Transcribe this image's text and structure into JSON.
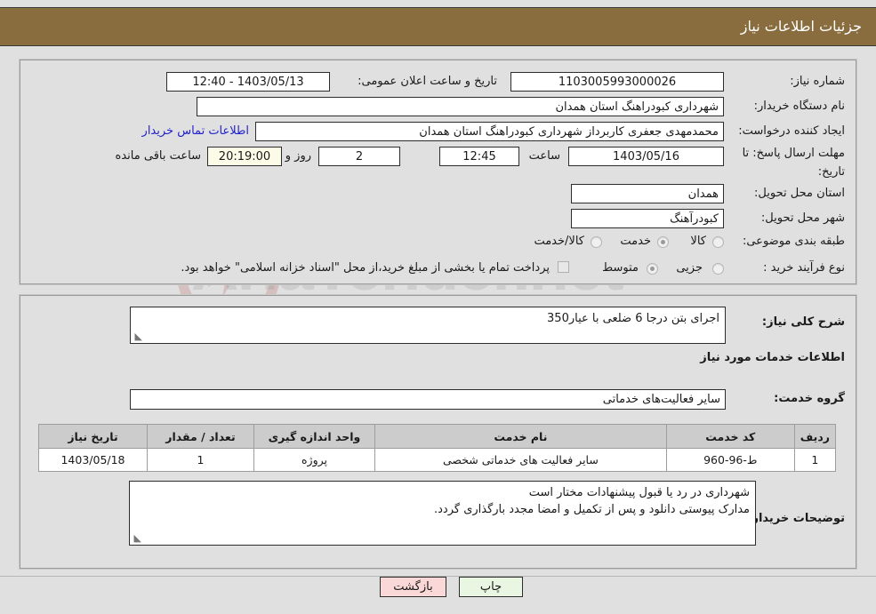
{
  "header": {
    "title": "جزئیات اطلاعات نیاز",
    "bg_color": "#8a6d3f",
    "text_color": "#ffffff"
  },
  "watermark": {
    "text": "AriaTender.net"
  },
  "top_form": {
    "need_number_label": "شماره نیاز:",
    "need_number_value": "1103005993000026",
    "public_announce_label": "تاریخ و ساعت اعلان عمومی:",
    "public_announce_value": "1403/05/13 - 12:40",
    "buyer_org_label": "نام دستگاه خریدار:",
    "buyer_org_value": "شهرداری کبودراهنگ استان همدان",
    "creator_label": "ایجاد کننده درخواست:",
    "creator_value": "محمدمهدی جعفری کاربرداز شهرداری کبودراهنگ استان همدان",
    "contact_link": "اطلاعات تماس خریدار",
    "deadline_label_line1": "مهلت ارسال پاسخ: تا",
    "deadline_label_line2": "تاریخ:",
    "deadline_date": "1403/05/16",
    "hour_label": "ساعت",
    "deadline_time": "12:45",
    "days_value": "2",
    "days_label": "روز و",
    "remaining_time": "20:19:00",
    "remaining_label": "ساعت باقی مانده",
    "province_label": "استان محل تحویل:",
    "province_value": "همدان",
    "city_label": "شهر محل تحویل:",
    "city_value": "کبودرآهنگ",
    "category_label": "طبقه بندی موضوعی:",
    "category_options": [
      "کالا",
      "خدمت",
      "کالا/خدمت"
    ],
    "category_selected": "خدمت",
    "process_label": "نوع فرآیند خرید :",
    "process_options": [
      "جزیی",
      "متوسط"
    ],
    "process_selected": "متوسط",
    "treasury_checkbox_label": "پرداخت تمام یا بخشی از مبلغ خرید،از محل \"اسناد خزانه اسلامی\" خواهد بود.",
    "treasury_checked": false
  },
  "mid_form": {
    "general_desc_label": "شرح کلی نیاز:",
    "general_desc_value": "اجرای بتن درجا 6 ضلعی با عیار350",
    "services_info_title": "اطلاعات خدمات مورد نیاز",
    "service_group_label": "گروه خدمت:",
    "service_group_value": "سایر فعالیت‌های خدماتی",
    "buyer_notes_label": "توضیحات خریدار:",
    "buyer_notes_value": "شهرداری در رد یا قبول پیشنهادات مختار است\nمدارک پیوستی دانلود و پس از تکمیل و امضا مجدد بارگذاری گردد."
  },
  "table": {
    "columns": [
      "ردیف",
      "کد خدمت",
      "نام خدمت",
      "واحد اندازه گیری",
      "تعداد / مقدار",
      "تاریخ نیاز"
    ],
    "rows": [
      {
        "row_no": "1",
        "service_code": "ط-96-960",
        "service_name": "سایر فعالیت های خدماتی شخصی",
        "unit": "پروژه",
        "quantity": "1",
        "need_date": "1403/05/18"
      }
    ]
  },
  "footer": {
    "print_label": "چاپ",
    "back_label": "بازگشت",
    "print_color": "#e8f6e2",
    "back_color": "#fbd8d8"
  }
}
